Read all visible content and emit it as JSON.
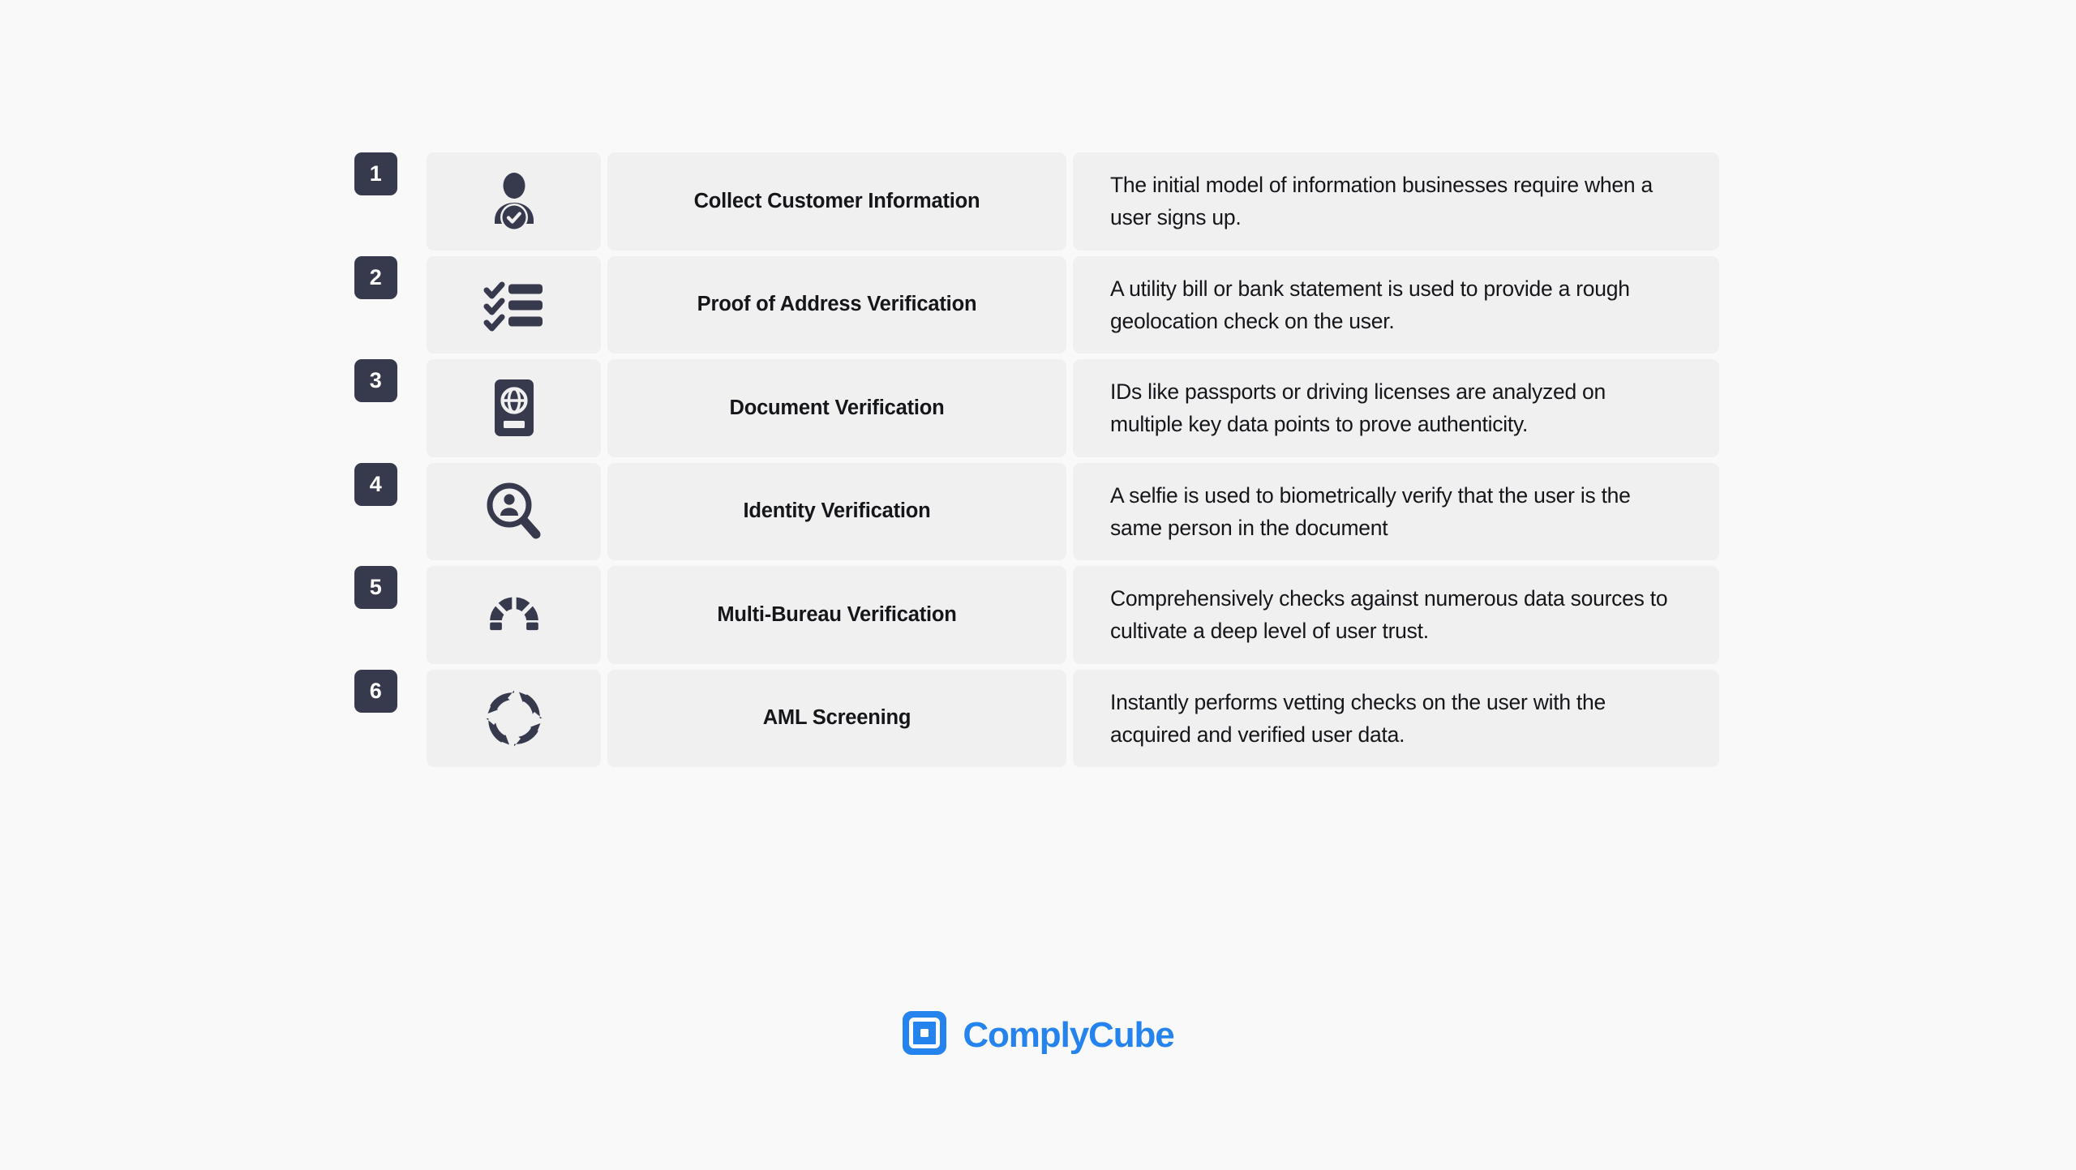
{
  "colors": {
    "background": "#f9f9fa",
    "panel": "#f0f0f1",
    "badge": "#373a4d",
    "icon": "#373a4d",
    "text": "#15161a",
    "brand": "#2483ec"
  },
  "steps": [
    {
      "number": "1",
      "icon": "person-check-icon",
      "title": "Collect Customer Information",
      "description": "The initial model of information businesses require when a user signs up."
    },
    {
      "number": "2",
      "icon": "checklist-icon",
      "title": "Proof of Address Verification",
      "description": "A utility bill or bank statement is used to provide a rough geolocation check on the user."
    },
    {
      "number": "3",
      "icon": "passport-globe-icon",
      "title": "Document Verification",
      "description": "IDs like passports or driving licenses are analyzed on multiple key data points to prove authenticity."
    },
    {
      "number": "4",
      "icon": "person-magnifier-icon",
      "title": "Identity Verification",
      "description": "A selfie is used to biometrically verify that the user is the same person in the document"
    },
    {
      "number": "5",
      "icon": "gauge-icon",
      "title": "Multi-Bureau Verification",
      "description": "Comprehensively checks against numerous data sources to cultivate a deep level of user trust."
    },
    {
      "number": "6",
      "icon": "recycle-cycle-icon",
      "title": "AML Screening",
      "description": "Instantly performs vetting checks on the user with the acquired and verified user data."
    }
  ],
  "brand": {
    "name": "ComplyCube",
    "mark": "complycube-logo-icon"
  }
}
